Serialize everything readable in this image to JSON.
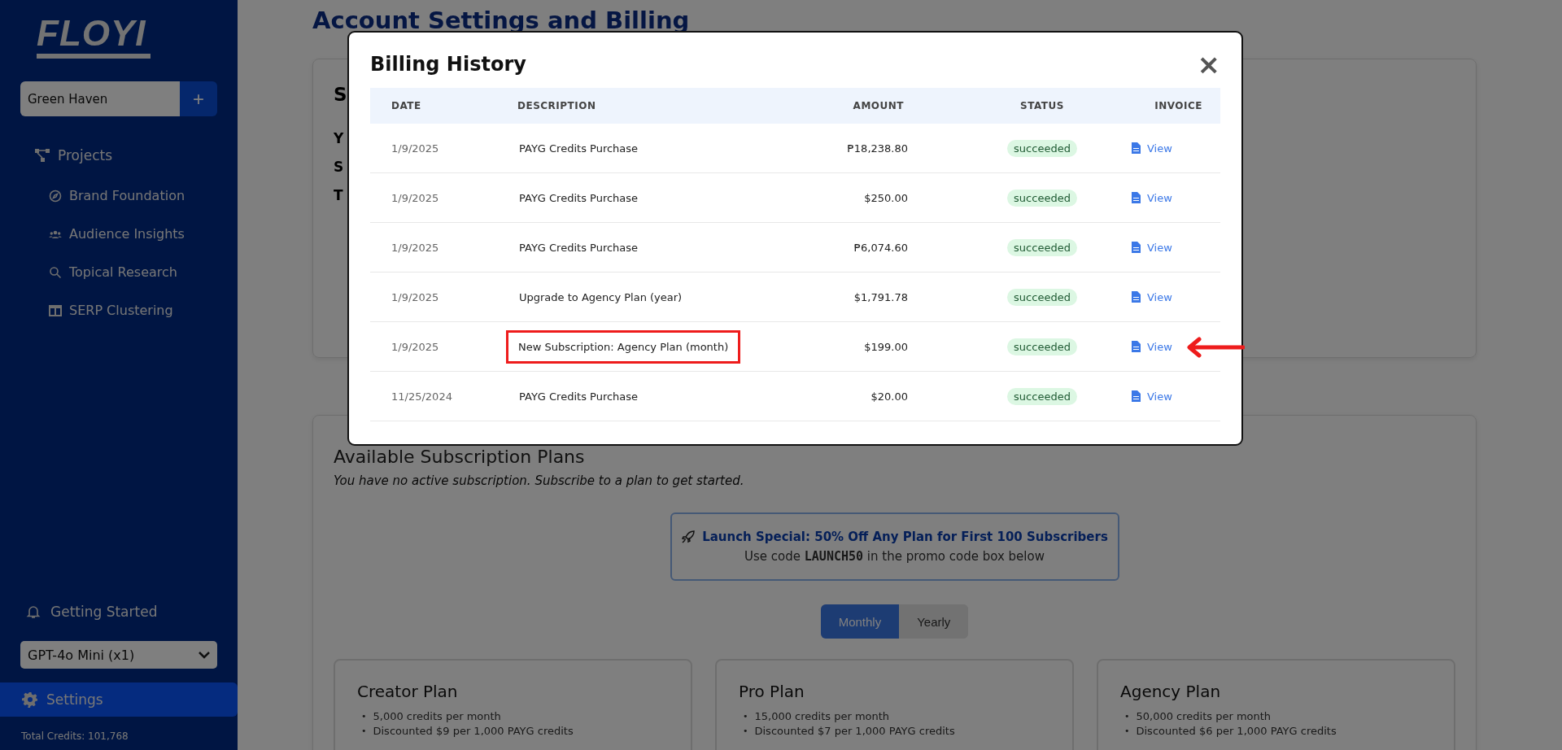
{
  "sidebar": {
    "logo": "FLOYI",
    "project_select": {
      "value": "Green Haven",
      "add_label": "+"
    },
    "nav": [
      {
        "label": "Projects",
        "selected": false,
        "children": [
          {
            "label": "Brand Foundation",
            "selected": false
          },
          {
            "label": "Audience Insights",
            "selected": false
          },
          {
            "label": "Topical Research",
            "selected": false
          },
          {
            "label": "SERP Clustering",
            "selected": false
          }
        ]
      }
    ],
    "getting_started": "Getting Started",
    "model_select": {
      "value": "GPT-4o Mini (x1)"
    },
    "settings": {
      "label": "Settings",
      "selected": true
    },
    "total_credits": "Total Credits: 101,768"
  },
  "page": {
    "title": "Account Settings and Billing",
    "subscription_card": {
      "title": "S",
      "lines": [
        "Y",
        "S",
        "T"
      ]
    },
    "plans": {
      "title": "Available Subscription Plans",
      "note": "You have no active subscription. Subscribe to a plan to get started.",
      "promo": {
        "headline": "Launch Special: 50% Off Any Plan for First 100 Subscribers",
        "text": "Use code **LAUNCH50** in the promo code box below"
      },
      "billing_toggle": [
        {
          "label": "Monthly",
          "selected": true
        },
        {
          "label": "Yearly",
          "selected": false
        }
      ],
      "bullet": "•",
      "cards": [
        {
          "name": "Creator Plan",
          "features": [
            "5,000 credits per month",
            "Discounted $9 per 1,000 PAYG credits"
          ]
        },
        {
          "name": "Pro Plan",
          "features": [
            "15,000 credits per month",
            "Discounted $7 per 1,000 PAYG credits"
          ]
        },
        {
          "name": "Agency Plan",
          "features": [
            "50,000 credits per month",
            "Discounted $6 per 1,000 PAYG credits"
          ]
        }
      ]
    }
  },
  "modal": {
    "title": "Billing History",
    "close": "×",
    "columns": [
      "DATE",
      "DESCRIPTION",
      "AMOUNT",
      "STATUS",
      "INVOICE"
    ],
    "rows": [
      {
        "date": "1/9/2025",
        "description": "PAYG Credits Purchase",
        "amount": "₱18,238.80",
        "status": "succeeded",
        "invoice": "View",
        "highlighted": false
      },
      {
        "date": "1/9/2025",
        "description": "PAYG Credits Purchase",
        "amount": "$250.00",
        "status": "succeeded",
        "invoice": "View",
        "highlighted": false
      },
      {
        "date": "1/9/2025",
        "description": "PAYG Credits Purchase",
        "amount": "₱6,074.60",
        "status": "succeeded",
        "invoice": "View",
        "highlighted": false
      },
      {
        "date": "1/9/2025",
        "description": "Upgrade to Agency Plan (year)",
        "amount": "$1,791.78",
        "status": "succeeded",
        "invoice": "View",
        "highlighted": false
      },
      {
        "date": "1/9/2025",
        "description": "New Subscription: Agency Plan (month)",
        "amount": "$199.00",
        "status": "succeeded",
        "invoice": "View",
        "highlighted": true
      },
      {
        "date": "11/25/2024",
        "description": "PAYG Credits Purchase",
        "amount": "$20.00",
        "status": "succeeded",
        "invoice": "View",
        "highlighted": false
      }
    ]
  }
}
